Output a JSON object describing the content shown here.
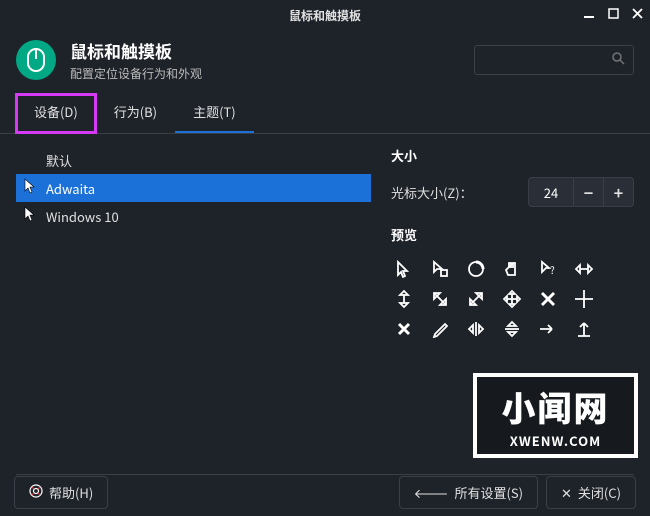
{
  "window": {
    "title": "鼠标和触摸板"
  },
  "header": {
    "title": "鼠标和触摸板",
    "subtitle": "配置定位设备行为和外观"
  },
  "tabs": {
    "device": "设备(D)",
    "behavior": "行为(B)",
    "theme": "主题(T)"
  },
  "themes": {
    "items": [
      "默认",
      "Adwaita",
      "Windows 10"
    ],
    "selected_index": 1
  },
  "size": {
    "section": "大小",
    "label": "光标大小(Z)：",
    "value": "24"
  },
  "preview": {
    "section": "预览"
  },
  "footer": {
    "help": "帮助(H)",
    "all_settings": "所有设置(S)",
    "close": "关闭(C)"
  },
  "watermark": {
    "main": "小闻网",
    "sub": "XWENW.COM"
  }
}
